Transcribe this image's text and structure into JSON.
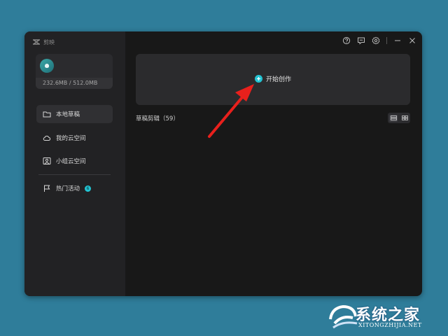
{
  "app": {
    "title": "剪映"
  },
  "user": {
    "storage": "232.6MB / 512.0MB"
  },
  "sidebar": {
    "items": [
      {
        "label": "本地草稿",
        "icon": "folder-icon",
        "active": true
      },
      {
        "label": "我的云空间",
        "icon": "cloud-icon",
        "active": false
      },
      {
        "label": "小组云空间",
        "icon": "team-icon",
        "active": false
      },
      {
        "label": "热门活动",
        "icon": "flag-icon",
        "active": false,
        "badge": "6"
      }
    ]
  },
  "main": {
    "create_label": "开始创作",
    "section_title": "草稿剪辑（59）"
  },
  "watermark": {
    "text": "系统之家",
    "url": "XITONGZHIJIA.NET"
  },
  "colors": {
    "accent": "#22c3d2",
    "arrow": "#e8201c",
    "window_bg": "#181818",
    "desktop_bg": "#2f7d9a"
  }
}
